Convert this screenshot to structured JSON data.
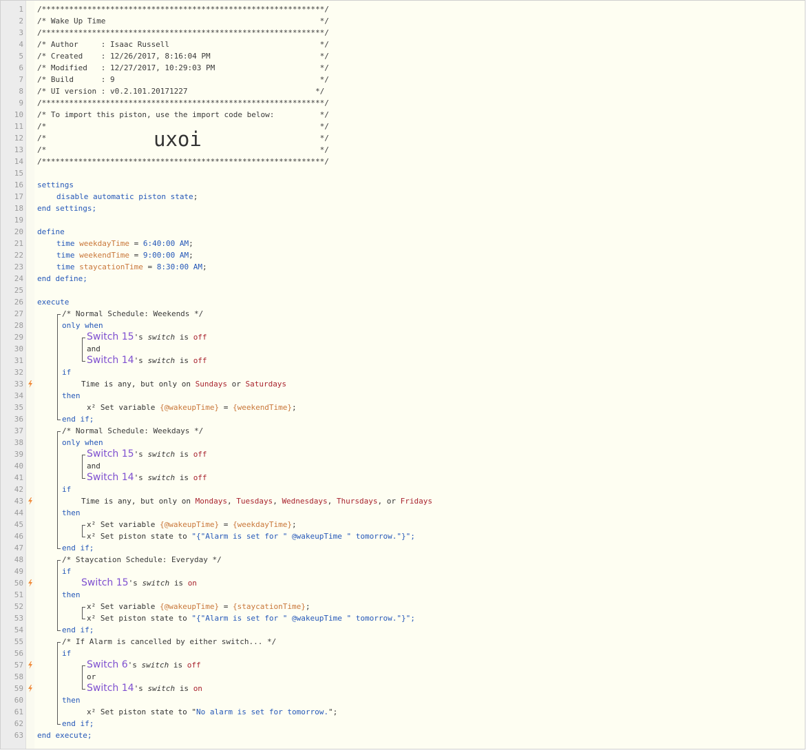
{
  "header": {
    "border_line": "/**************************************************************/",
    "title_line": "/* Wake Up Time                                               */",
    "author_line": "/* Author     : Isaac Russell                                 */",
    "created_line": "/* Created    : 12/26/2017, 8:16:04 PM                        */",
    "modified_line": "/* Modified   : 12/27/2017, 10:29:03 PM                       */",
    "build_line": "/* Build      : 9                                             */",
    "ui_line": "/* UI version : v0.2.101.20171227                            */",
    "import_line": "/* To import this piston, use the import code below:          */",
    "blank_line": "/*                                                            */",
    "import_pre": "/*",
    "import_post": "*/",
    "import_code": "uxoi"
  },
  "keywords": {
    "settings": "settings",
    "disable": "disable",
    "automatic_state": "automatic piston state",
    "end_settings": "end settings;",
    "define": "define",
    "time": "time",
    "end_define": "end define;",
    "execute": "execute",
    "only_when": "only when",
    "if": "if",
    "then": "then",
    "end_if": "end if;",
    "and": "and",
    "or": "or",
    "end_execute": "end execute;"
  },
  "defines": [
    {
      "type": "time",
      "name": "weekdayTime",
      "value": "6:40:00 AM"
    },
    {
      "type": "time",
      "name": "weekendTime",
      "value": "9:00:00 AM"
    },
    {
      "type": "time",
      "name": "staycationTime",
      "value": "8:30:00 AM"
    }
  ],
  "comments": {
    "weekends": "/* Normal Schedule: Weekends */",
    "weekdays": "/* Normal Schedule: Weekdays */",
    "staycation": "/* Staycation Schedule: Everyday */",
    "cancelled": "/* If Alarm is cancelled by either switch... */"
  },
  "devices": {
    "sw15": "Switch 15",
    "sw14": "Switch 14",
    "sw6": "Switch 6"
  },
  "text": {
    "poss": "'s",
    "switch_attr": "switch",
    "is": "is",
    "off": "off",
    "on": "on",
    "time_word": "Time",
    "is_any": "is any, but only on",
    "comma": ",",
    "or_word": "or",
    "sundays": "Sundays",
    "saturdays": "Saturdays",
    "mondays": "Mondays",
    "tuesdays": "Tuesdays",
    "wednesdays": "Wednesdays",
    "thursdays": "Thursdays",
    "fridays": "Fridays",
    "x2": "x²",
    "set_variable": "Set variable",
    "set_state": "Set piston state to",
    "wakeup_var": "{@wakeupTime}",
    "eq": "=",
    "weekend_expr": "{weekendTime}",
    "weekday_expr": "{weekdayTime}",
    "staycation_expr": "{staycationTime}",
    "alarm_expr": "\"{\"Alarm is set for \" @wakeupTime \" tomorrow.\"}\";",
    "no_alarm": "No alarm is set for tomorrow.",
    "semicolon": ";"
  },
  "line_numbers": [
    "1",
    "2",
    "3",
    "4",
    "5",
    "6",
    "7",
    "8",
    "9",
    "10",
    "11",
    "12",
    "13",
    "14",
    "15",
    "16",
    "17",
    "18",
    "19",
    "20",
    "21",
    "22",
    "23",
    "24",
    "25",
    "26",
    "27",
    "28",
    "29",
    "30",
    "31",
    "32",
    "33",
    "34",
    "35",
    "36",
    "37",
    "38",
    "39",
    "40",
    "41",
    "42",
    "43",
    "44",
    "45",
    "46",
    "47",
    "48",
    "49",
    "50",
    "51",
    "52",
    "53",
    "54",
    "55",
    "56",
    "57",
    "58",
    "59",
    "60",
    "61",
    "62",
    "63"
  ],
  "trigger_lines": [
    33,
    43,
    50,
    57,
    59
  ],
  "colors": {
    "background": "#fefef2",
    "gutter": "#ececec",
    "keyword": "#2457b8",
    "variable": "#c9773a",
    "literal": "#a8232e",
    "device": "#7e4fd0",
    "bolt": "#f08a3a"
  }
}
